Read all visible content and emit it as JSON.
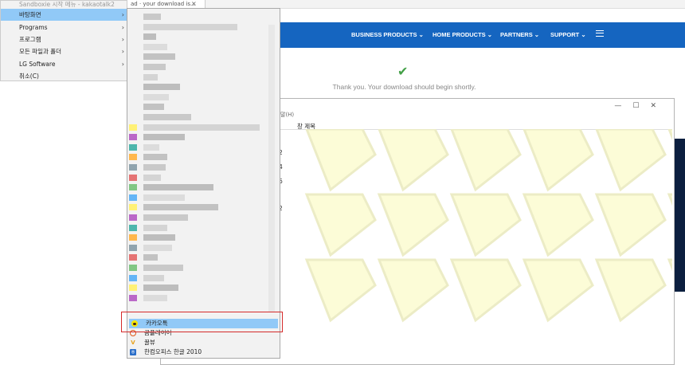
{
  "browser": {
    "tab_title": "ad · your download is...",
    "tab_close": "×"
  },
  "site": {
    "nav": [
      {
        "label": "BUSINESS PRODUCTS ⌄"
      },
      {
        "label": "HOME PRODUCTS ⌄"
      },
      {
        "label": "PARTNERS ⌄"
      },
      {
        "label": "SUPPORT ⌄"
      }
    ],
    "check_glyph": "✔",
    "thank_you": "Thank you. Your download should begin shortly."
  },
  "explorer": {
    "menu_fragment": "말(H)",
    "controls": "—☐✕",
    "column_header": "창 제목",
    "row_numbers": [
      "",
      "2",
      "4",
      "6",
      "",
      "2"
    ],
    "tile_color": "#fcfcd7",
    "tile_border": "#ececc6"
  },
  "submenu": {
    "items": [
      {
        "label": "Sandboxie 시작 메뉴 - kakaotalk2",
        "has_arrow": false
      },
      {
        "label": "바탕화면",
        "has_arrow": true
      },
      {
        "label": "Programs",
        "has_arrow": true
      },
      {
        "label": "프로그램",
        "has_arrow": true
      },
      {
        "label": "모든 파일과 폴더",
        "has_arrow": true
      },
      {
        "label": "LG Software",
        "has_arrow": true
      },
      {
        "label": "취소(C)",
        "has_arrow": false
      }
    ],
    "arrow_glyph": "›"
  },
  "programs": {
    "items": [
      {
        "label": "카카오톡",
        "icon": "kakaotalk-icon",
        "icon_color": "#3c1e1e"
      },
      {
        "label": "곰플레이어",
        "icon": "gom-player-icon",
        "icon_color": "#e05a1a"
      },
      {
        "label": "꿀뷰",
        "icon": "honeyview-icon",
        "icon_color": "#e8a21c"
      },
      {
        "label": "한컴오피스 한글 2010",
        "icon": "hancom-hwp-icon",
        "icon_color": "#2a6ec9"
      }
    ],
    "highlight_color": "#d42a2a"
  },
  "colors": {
    "nav_blue": "#1565c0",
    "dark_band": "#0c1f3f",
    "selection": "#91c9f7",
    "menu_bg": "#f2f2f2",
    "yellow": "#f7d21a"
  }
}
